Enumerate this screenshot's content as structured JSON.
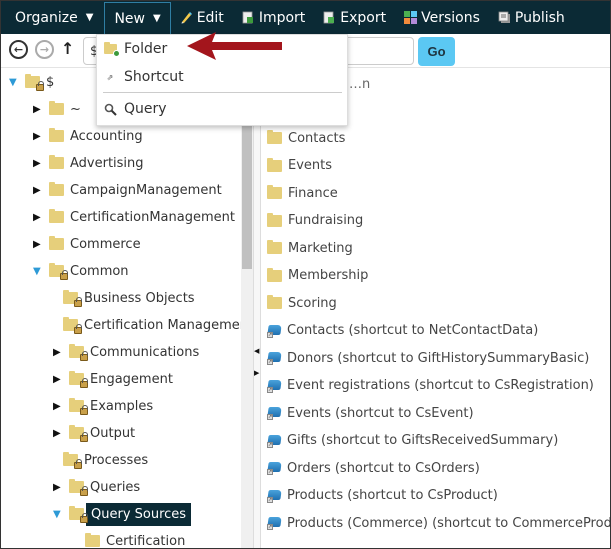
{
  "toolbar": {
    "items": [
      {
        "label": "Organize",
        "icon": "none",
        "caret": "▼"
      },
      {
        "label": "New",
        "icon": "none",
        "caret": "▼",
        "active": true
      },
      {
        "label": "Edit",
        "icon": "pencil-icon"
      },
      {
        "label": "Import",
        "icon": "import-icon"
      },
      {
        "label": "Export",
        "icon": "export-icon"
      },
      {
        "label": "Versions",
        "icon": "versions-icon"
      },
      {
        "label": "Publish",
        "icon": "publish-icon"
      }
    ]
  },
  "nav": {
    "back_icon": "←",
    "forward_icon": "→",
    "up_icon": "↑",
    "path_value": "$",
    "go_label": "Go"
  },
  "new_menu": {
    "items": [
      {
        "label": "Folder",
        "icon": "folder-add-icon"
      },
      {
        "label": "Shortcut",
        "icon": "shortcut-icon"
      },
      {
        "label": "Query",
        "icon": "query-icon"
      }
    ]
  },
  "tree": {
    "items": [
      {
        "label": "$",
        "toggle": "▼",
        "locked": true,
        "level": 0
      },
      {
        "label": "~",
        "toggle": "▶",
        "locked": false,
        "level": 1
      },
      {
        "label": "Accounting",
        "toggle": "▶",
        "locked": false,
        "level": 1
      },
      {
        "label": "Advertising",
        "toggle": "▶",
        "locked": false,
        "level": 1
      },
      {
        "label": "CampaignManagement",
        "toggle": "▶",
        "locked": false,
        "level": 1
      },
      {
        "label": "CertificationManagement",
        "toggle": "▶",
        "locked": false,
        "level": 1
      },
      {
        "label": "Commerce",
        "toggle": "▶",
        "locked": false,
        "level": 1
      },
      {
        "label": "Common",
        "toggle": "▼",
        "locked": true,
        "level": 1
      },
      {
        "label": "Business Objects",
        "toggle": "",
        "locked": true,
        "level": 2
      },
      {
        "label": "Certification Management",
        "toggle": "",
        "locked": true,
        "level": 2
      },
      {
        "label": "Communications",
        "toggle": "▶",
        "locked": true,
        "level": 2
      },
      {
        "label": "Engagement",
        "toggle": "▶",
        "locked": true,
        "level": 2
      },
      {
        "label": "Examples",
        "toggle": "▶",
        "locked": true,
        "level": 2
      },
      {
        "label": "Output",
        "toggle": "▶",
        "locked": true,
        "level": 2
      },
      {
        "label": "Processes",
        "toggle": "",
        "locked": true,
        "level": 2
      },
      {
        "label": "Queries",
        "toggle": "▶",
        "locked": true,
        "level": 2
      },
      {
        "label": "Query Sources",
        "toggle": "▼",
        "locked": true,
        "level": 2,
        "selected": true
      },
      {
        "label": "Certification",
        "toggle": "",
        "locked": false,
        "level": 3
      }
    ]
  },
  "list": {
    "partial_hidden": [
      "…n"
    ],
    "folders": [
      "Contacts",
      "Events",
      "Finance",
      "Fundraising",
      "Marketing",
      "Membership",
      "Scoring"
    ],
    "shortcuts": [
      "Contacts (shortcut to NetContactData)",
      "Donors (shortcut to GiftHistorySummaryBasic)",
      "Event registrations (shortcut to CsRegistration)",
      "Events (shortcut to CsEvent)",
      "Gifts (shortcut to GiftsReceivedSummary)",
      "Orders (shortcut to CsOrders)",
      "Products (shortcut to CsProduct)",
      "Products (Commerce) (shortcut to CommerceProduct)"
    ]
  },
  "colors": {
    "toolbar_bg": "#0b2a35",
    "selected_bg": "#0b2a35",
    "go_button": "#5bc8f3",
    "folder": "#e6cf7b",
    "callout_arrow": "#a3151c",
    "tree_open_toggle": "#2d9ad6"
  }
}
